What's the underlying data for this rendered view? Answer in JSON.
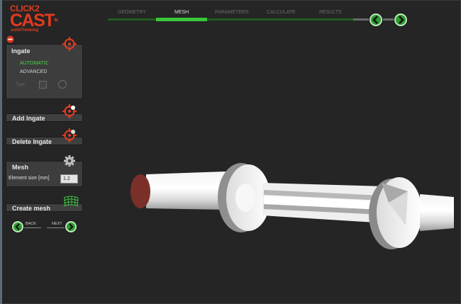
{
  "logo": {
    "line1": "CLICK2",
    "line2": "CAST",
    "line3": "solidThinking",
    "tm": "TM"
  },
  "steps": [
    {
      "label": "GEOMETRY",
      "active": false
    },
    {
      "label": "MESH",
      "active": true
    },
    {
      "label": "PARAMETERS",
      "active": false
    },
    {
      "label": "CALCULATE",
      "active": false
    },
    {
      "label": "RESULTS",
      "active": false
    }
  ],
  "ingate": {
    "title": "Ingate",
    "automatic": "AUTOMATIC",
    "advanced": "ADVANCED",
    "type_label": "Type"
  },
  "actions": {
    "add_ingate": "Add Ingate",
    "delete_ingate": "Delete Ingate",
    "create_mesh": "Create mesh"
  },
  "mesh": {
    "title": "Mesh",
    "element_size_label": "Element size [mm]",
    "element_size_value": "1.2"
  },
  "nav": {
    "back": "BACK",
    "next": "NEXT"
  },
  "colors": {
    "accent_green": "#39c639",
    "brand_red": "#e23a1e",
    "background": "#252525"
  },
  "icons": {
    "target": "crosshair-target-icon",
    "gear": "gear-icon",
    "mesh": "mesh-grid-icon",
    "collapse": "minus-circle-icon"
  }
}
